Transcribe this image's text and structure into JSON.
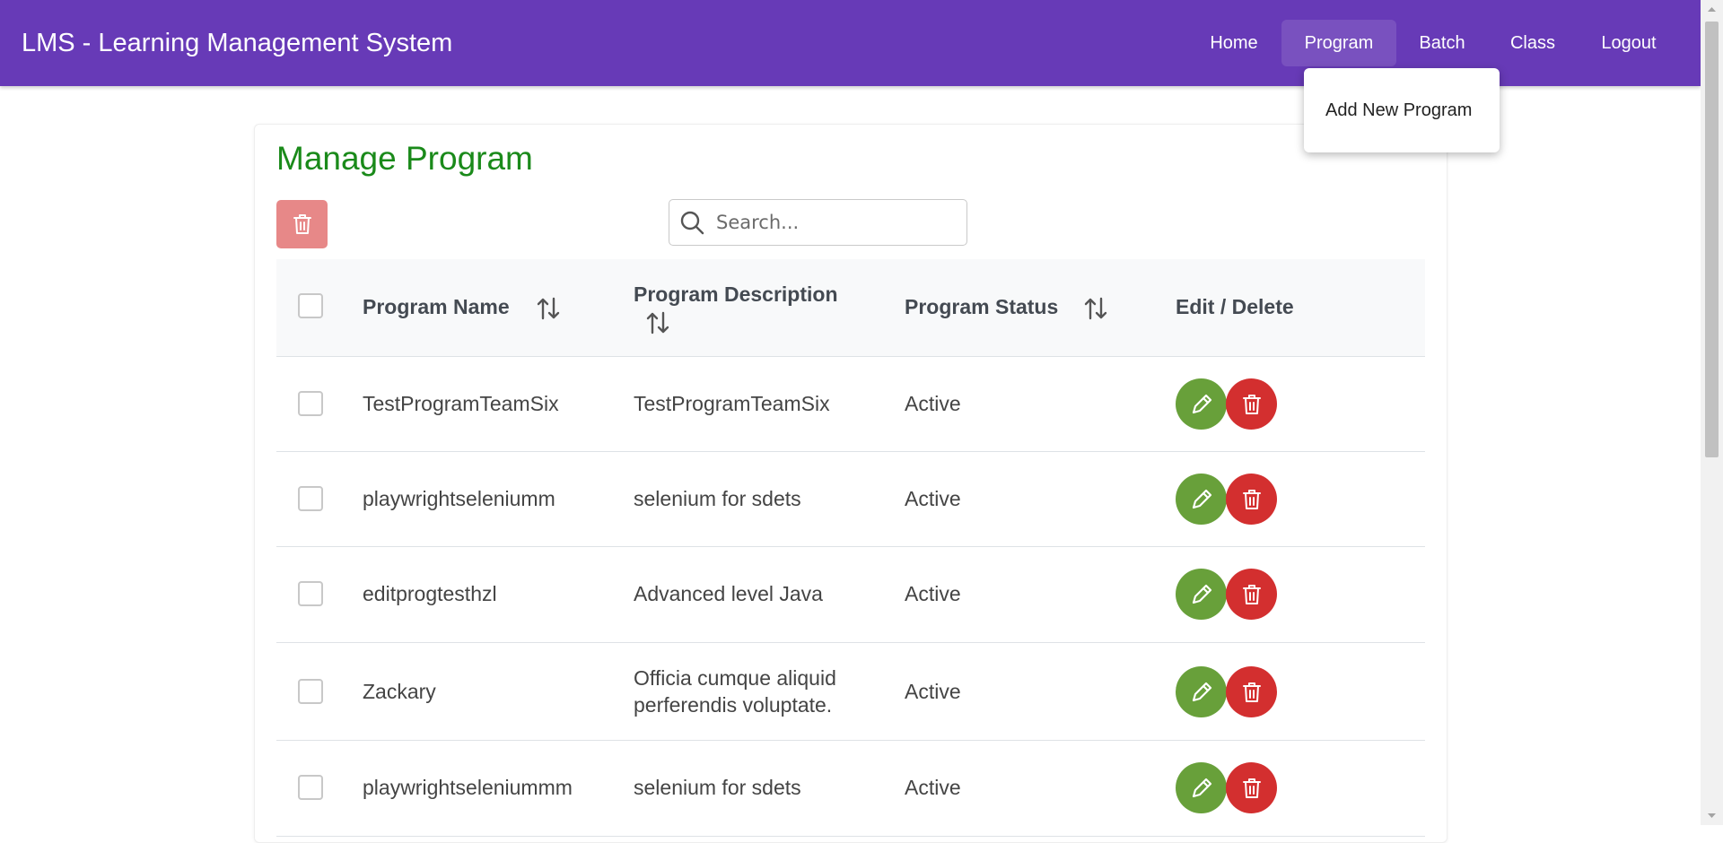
{
  "header": {
    "app_title": "LMS - Learning Management System",
    "nav": [
      "Home",
      "Program",
      "Batch",
      "Class",
      "Logout"
    ],
    "active_nav": "Program",
    "color": "#673ab7"
  },
  "dropdown": {
    "items": [
      "Add New Program"
    ]
  },
  "page": {
    "title": "Manage Program",
    "search_placeholder": "Search...",
    "search_value": ""
  },
  "table": {
    "headers": [
      "Program Name",
      "Program Description",
      "Program Status",
      "Edit / Delete"
    ],
    "rows": [
      {
        "name": "TestProgramTeamSix",
        "description": "TestProgramTeamSix",
        "status": "Active"
      },
      {
        "name": "playwrightseleniumm",
        "description": "selenium for sdets",
        "status": "Active"
      },
      {
        "name": "editprogtesthzl",
        "description": "Advanced level Java",
        "status": "Active"
      },
      {
        "name": "Zackary",
        "description": "Officia cumque aliquid perferendis voluptate.",
        "description_lines": [
          "Officia cumque aliquid",
          "perferendis voluptate."
        ],
        "status": "Active"
      },
      {
        "name": "playwrightseleniummm",
        "description": "selenium for sdets",
        "status": "Active"
      }
    ]
  },
  "icons": {
    "bulk_delete": "trash-icon",
    "search": "search-icon",
    "sort": "sort-icon",
    "edit": "pencil-icon",
    "delete": "trash-icon"
  },
  "colors": {
    "title_green": "#1a8a1a",
    "edit_green": "#68a03a",
    "delete_red": "#d32f2f",
    "bulk_delete_red": "#e78888"
  }
}
